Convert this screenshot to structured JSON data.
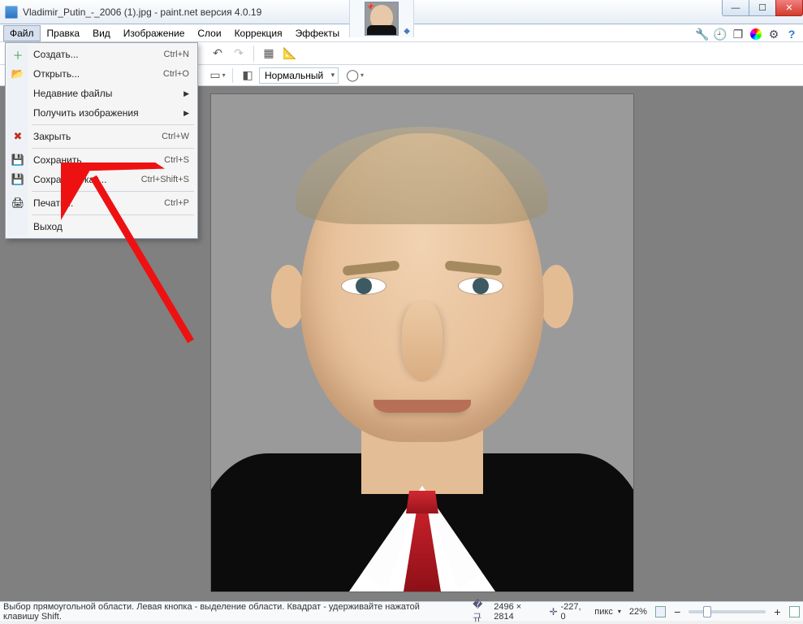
{
  "title": "Vladimir_Putin_-_2006 (1).jpg - paint.net версия 4.0.19",
  "menubar": [
    "Файл",
    "Правка",
    "Вид",
    "Изображение",
    "Слои",
    "Коррекция",
    "Эффекты"
  ],
  "topright_icons": [
    "wrench-icon",
    "clock-icon",
    "layers-icon",
    "color-wheel-icon",
    "gear-icon",
    "help-icon"
  ],
  "file_menu": {
    "items": [
      {
        "icon": "＋",
        "label": "Создать...",
        "shortcut": "Ctrl+N"
      },
      {
        "icon": "📂",
        "label": "Открыть...",
        "shortcut": "Ctrl+O"
      },
      {
        "icon": "",
        "label": "Недавние файлы",
        "submenu": true
      },
      {
        "icon": "",
        "label": "Получить изображения",
        "submenu": true
      },
      {
        "sep": true
      },
      {
        "icon": "✕",
        "label": "Закрыть",
        "shortcut": "Ctrl+W"
      },
      {
        "sep": true
      },
      {
        "icon": "💾",
        "label": "Сохранить",
        "shortcut": "Ctrl+S"
      },
      {
        "icon": "💾",
        "label": "Сохранить как...",
        "shortcut": "Ctrl+Shift+S"
      },
      {
        "sep": true
      },
      {
        "icon": "🖨",
        "label": "Печать...",
        "shortcut": "Ctrl+P"
      },
      {
        "sep": true
      },
      {
        "icon": "",
        "label": "Выход",
        "shortcut": ""
      }
    ]
  },
  "toolbar2": {
    "blend_label": "Нормальный"
  },
  "status": {
    "hint": "Выбор прямоугольной области. Левая кнопка - выделение области. Квадрат - удерживайте нажатой клавишу Shift.",
    "dims": "2496 × 2814",
    "cursor": "-227, 0",
    "units": "пикс",
    "zoom": "22%"
  }
}
